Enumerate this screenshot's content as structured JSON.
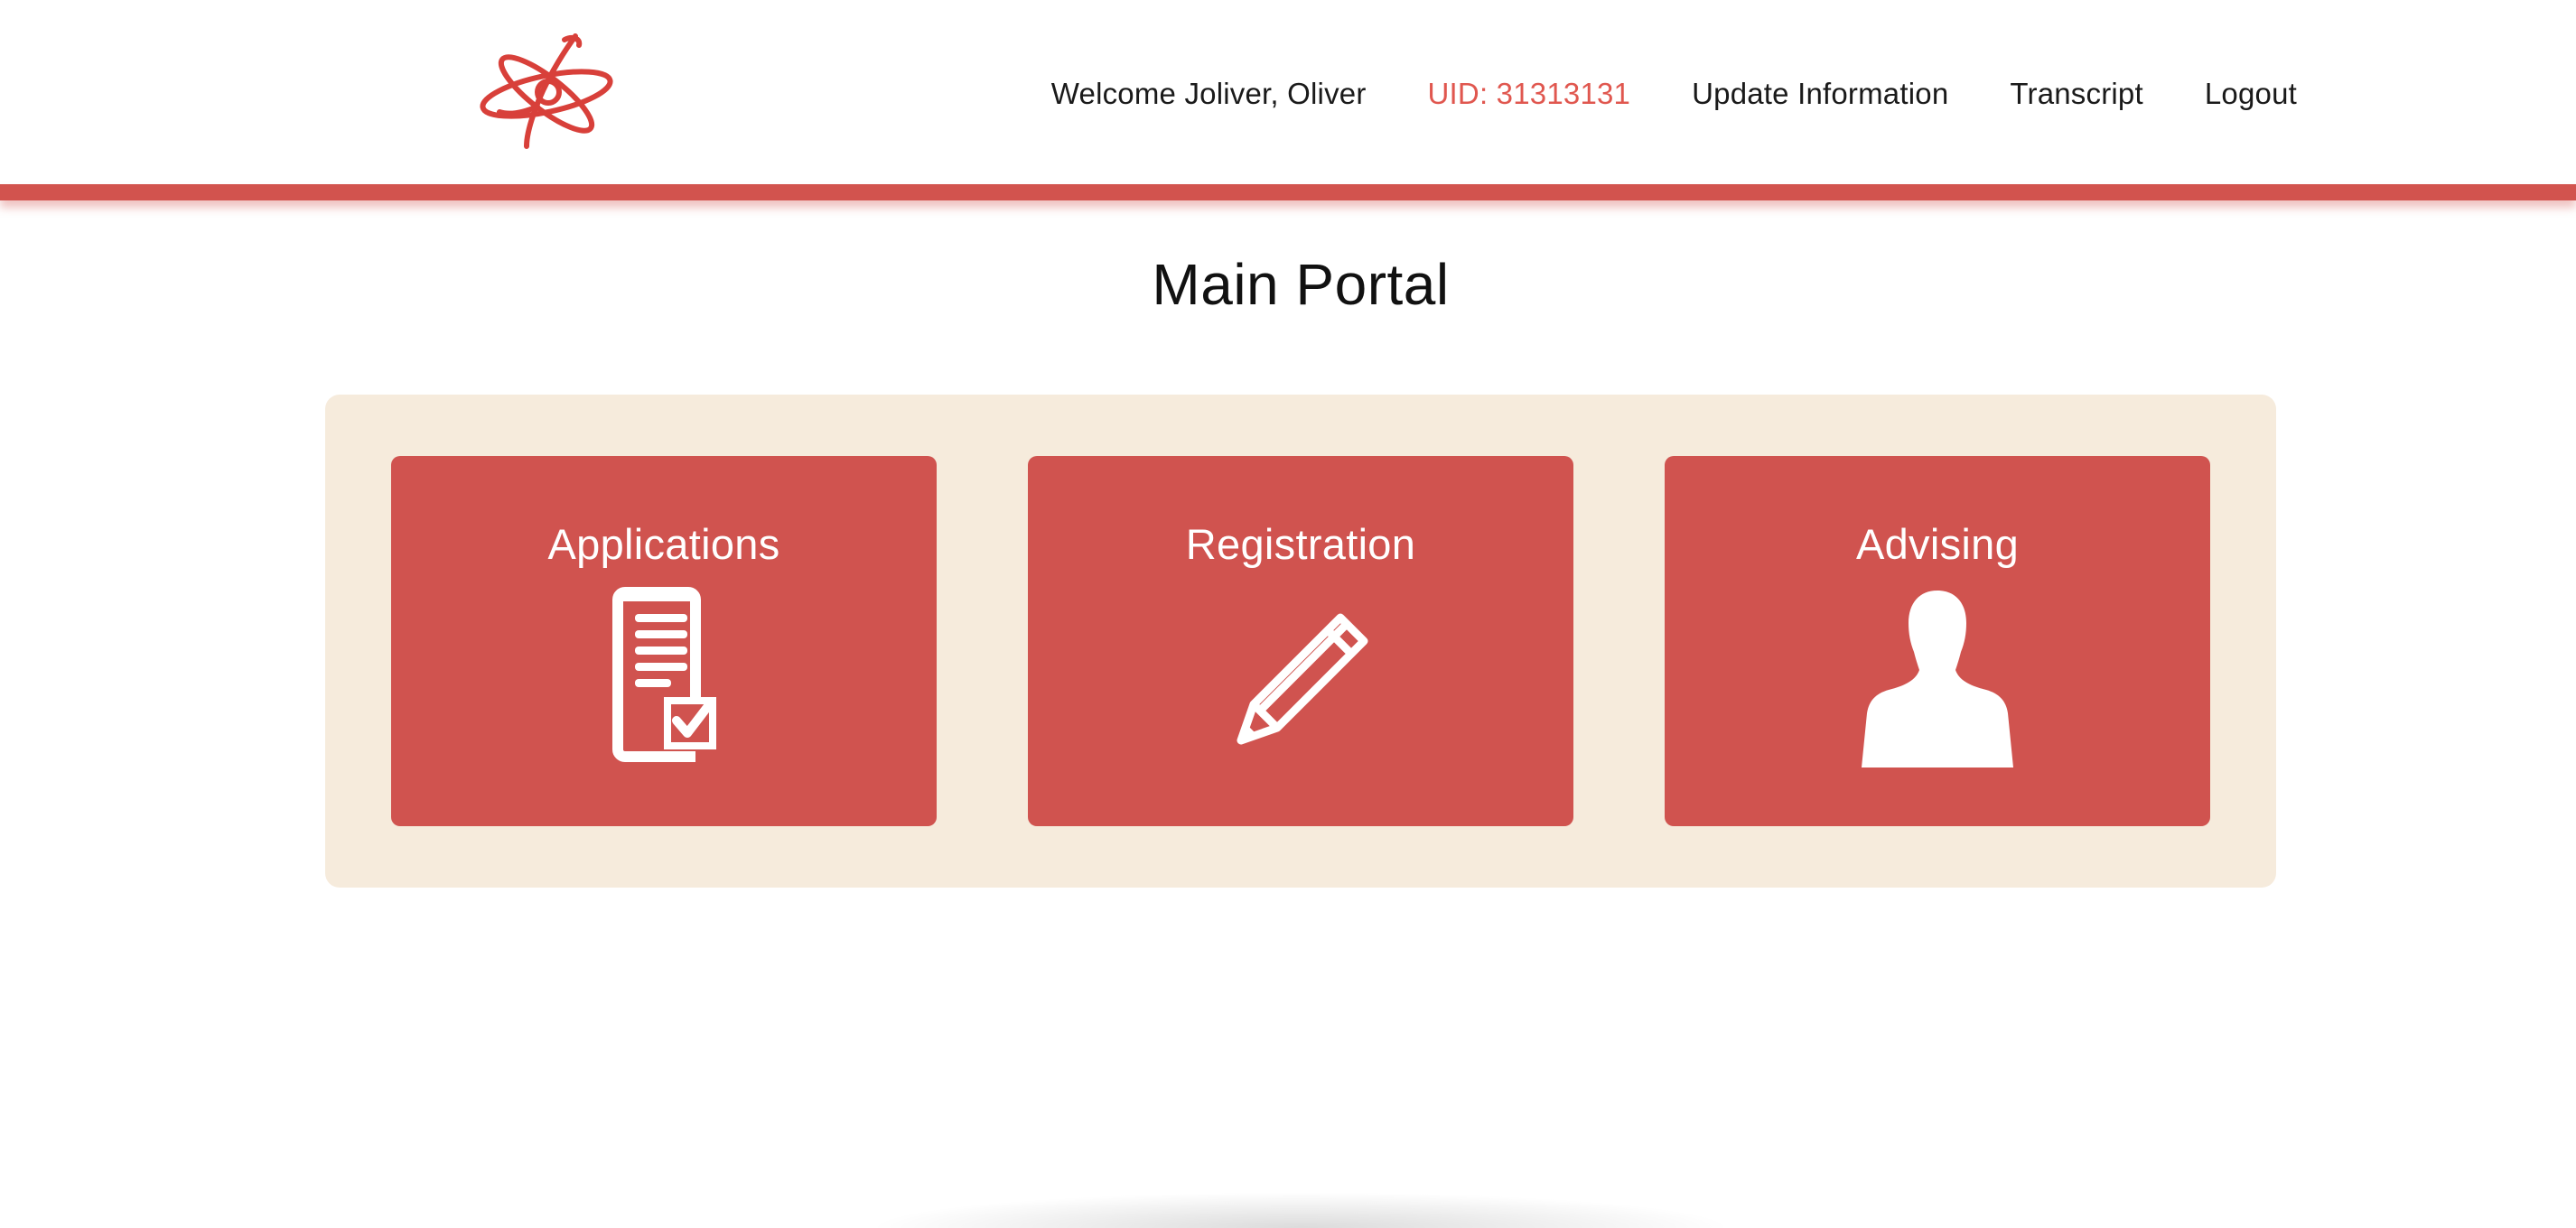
{
  "header": {
    "logo_icon": "atom-swirl-logo-icon",
    "nav": {
      "welcome": "Welcome Joliver, Oliver",
      "uid": "UID: 31313131",
      "update_information": "Update Information",
      "transcript": "Transcript",
      "logout": "Logout"
    }
  },
  "main": {
    "title": "Main Portal",
    "cards": [
      {
        "label": "Applications",
        "icon": "document-checkmark-icon"
      },
      {
        "label": "Registration",
        "icon": "pencil-icon"
      },
      {
        "label": "Advising",
        "icon": "person-silhouette-icon"
      }
    ]
  },
  "colors": {
    "accent": "#d2534e",
    "card": "#d0534f",
    "panel": "#f6ebdc",
    "uid_text": "#e0574f"
  }
}
